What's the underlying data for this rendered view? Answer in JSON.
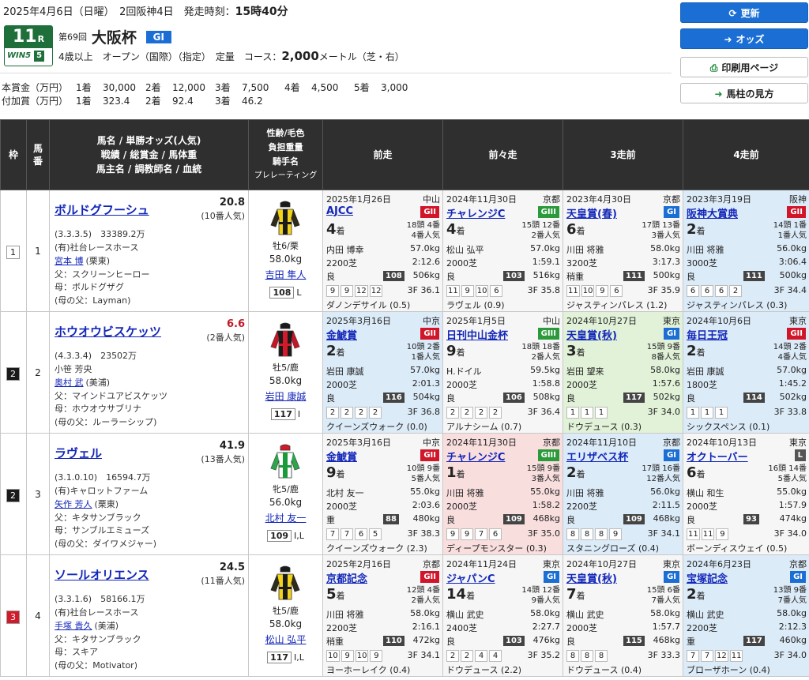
{
  "header": {
    "date_text": "2025年4月6日（日曜）　2回阪神4日　発走時刻：",
    "post_time": "15時40分",
    "race_number": "11",
    "race_number_suffix": "R",
    "win5_label": "WIN5",
    "win5_number": "5",
    "kai": "第69回",
    "race_name": "大阪杯",
    "grade": "GI",
    "conditions": "4歳以上　オープン（国際）（指定）　定量　コース：",
    "distance": "2,000",
    "course_detail": "メートル（芝・右）",
    "prize_label": "本賞金（万円）",
    "prize": [
      "1着",
      "30,000",
      "2着",
      "12,000",
      "3着",
      "7,500",
      "4着",
      "4,500",
      "5着",
      "3,000"
    ],
    "bonus_label": "付加賞（万円）",
    "bonus": [
      "1着",
      "323.4",
      "2着",
      "92.4",
      "3着",
      "46.2"
    ]
  },
  "buttons": {
    "refresh": "更新",
    "odds": "オッズ",
    "print": "印刷用ページ",
    "guide": "馬柱の見方"
  },
  "table_headers": {
    "waku": "枠",
    "umaban": "馬番",
    "horse_line1": "馬名 / 単勝オッズ(人気)",
    "horse_line2": "戦績 / 総賞金 / 馬体重",
    "horse_line3": "馬主名 / 調教師名 / 血統",
    "jockey_line1": "性齢/毛色",
    "jockey_line2": "負担重量",
    "jockey_line3": "騎手名",
    "jockey_line4": "プレレーティング",
    "past1": "前走",
    "past2": "前々走",
    "past3": "3走前",
    "past4": "4走前"
  },
  "horses": [
    {
      "waku": "1",
      "umaban": "1",
      "name": "ボルドグフーシュ",
      "odds": "20.8",
      "ninki": "(10番人気)",
      "record": "(3.3.3.5)　33389.2万",
      "owner": "(有)社台レースホース",
      "trainer": "宮本 博",
      "trainer_loc": "(栗東)",
      "sire": "父：スクリーンヒーロー",
      "dam": "母：ボルドグザグ",
      "damsire": "(母の父：Layman)",
      "sex": "牡6/栗",
      "weight": "58.0kg",
      "jockey": "吉田 隼人",
      "rating": "108",
      "rating_mark": "L",
      "silk": {
        "body": "#f2d21a",
        "stripe": "#1a1a1a",
        "sleeve": "#1a1a1a",
        "cap": "#1a1a1a"
      },
      "past": [
        {
          "date": "2025年1月26日",
          "venue": "中山",
          "race": "AJCC",
          "grade": "GII",
          "gclass": "gii",
          "rank": "4",
          "field": "18頭 4番",
          "pop": "4番人気",
          "jockey": "内田 博幸",
          "jw": "57.0kg",
          "course": "2200芝",
          "time": "2:12.6",
          "track": "良",
          "idx": "108",
          "bw": "506kg",
          "pos": [
            "9",
            "9",
            "12",
            "12"
          ],
          "f3": "3F 36.1",
          "winner": "ダノンデサイル (0.5)",
          "bg": "c0"
        },
        {
          "date": "2024年11月30日",
          "venue": "京都",
          "race": "チャレンジC",
          "grade": "GIII",
          "gclass": "giii",
          "rank": "4",
          "field": "15頭 12番",
          "pop": "2番人気",
          "jockey": "松山 弘平",
          "jw": "57.0kg",
          "course": "2000芝",
          "time": "1:59.1",
          "track": "良",
          "idx": "103",
          "bw": "516kg",
          "pos": [
            "11",
            "9",
            "10",
            "6"
          ],
          "f3": "3F 35.8",
          "winner": "ラヴェル (0.9)",
          "bg": "c0"
        },
        {
          "date": "2023年4月30日",
          "venue": "京都",
          "race": "天皇賞(春)",
          "grade": "GI",
          "gclass": "gi",
          "rank": "6",
          "field": "17頭 13番",
          "pop": "3番人気",
          "jockey": "川田 将雅",
          "jw": "58.0kg",
          "course": "3200芝",
          "time": "3:17.3",
          "track": "稍重",
          "idx": "111",
          "bw": "500kg",
          "pos": [
            "11",
            "10",
            "9",
            "6"
          ],
          "f3": "3F 35.9",
          "winner": "ジャスティンパレス (1.2)",
          "bg": "c0"
        },
        {
          "date": "2023年3月19日",
          "venue": "阪神",
          "race": "阪神大賞典",
          "grade": "GII",
          "gclass": "gii",
          "rank": "2",
          "field": "14頭 1番",
          "pop": "1番人気",
          "jockey": "川田 将雅",
          "jw": "56.0kg",
          "course": "3000芝",
          "time": "3:06.4",
          "track": "良",
          "idx": "111",
          "bw": "500kg",
          "pos": [
            "6",
            "6",
            "6",
            "2"
          ],
          "f3": "3F 34.4",
          "winner": "ジャスティンパレス (0.3)",
          "bg": "c1"
        }
      ]
    },
    {
      "waku": "2",
      "umaban": "2",
      "name": "ホウオウビスケッツ",
      "odds": "6.6",
      "ninki": "(2番人気)",
      "record": "(4.3.3.4)　23502万",
      "owner": "小笹 芳央",
      "trainer": "奥村 武",
      "trainer_loc": "(美浦)",
      "sire": "父：マインドユアビスケッツ",
      "dam": "母：ホウオウサブリナ",
      "damsire": "(母の父：ルーラーシップ)",
      "sex": "牡5/鹿",
      "weight": "58.0kg",
      "jockey": "岩田 康誠",
      "rating": "117",
      "rating_mark": "I",
      "silk": {
        "body": "#1a1a1a",
        "stripe": "#d21a2a",
        "sleeve": "#d21a2a",
        "cap": "#1a1a1a"
      },
      "past": [
        {
          "date": "2025年3月16日",
          "venue": "中京",
          "race": "金鯱賞",
          "grade": "GII",
          "gclass": "gii",
          "rank": "2",
          "field": "10頭 2番",
          "pop": "1番人気",
          "jockey": "岩田 康誠",
          "jw": "57.0kg",
          "course": "2000芝",
          "time": "2:01.3",
          "track": "良",
          "idx": "116",
          "bw": "504kg",
          "pos": [
            "2",
            "2",
            "2",
            "2"
          ],
          "f3": "3F 36.8",
          "winner": "クイーンズウォーク (0.0)",
          "bg": "c1"
        },
        {
          "date": "2025年1月5日",
          "venue": "中山",
          "race": "日刊中山金杯",
          "grade": "GIII",
          "gclass": "giii",
          "rank": "9",
          "field": "18頭 18番",
          "pop": "2番人気",
          "jockey": "H.ドイル",
          "jw": "59.5kg",
          "course": "2000芝",
          "time": "1:58.8",
          "track": "良",
          "idx": "106",
          "bw": "508kg",
          "pos": [
            "2",
            "2",
            "2",
            "2"
          ],
          "f3": "3F 36.4",
          "winner": "アルナシーム (0.7)",
          "bg": "c0"
        },
        {
          "date": "2024年10月27日",
          "venue": "東京",
          "race": "天皇賞(秋)",
          "grade": "GI",
          "gclass": "gi",
          "rank": "3",
          "field": "15頭 9番",
          "pop": "8番人気",
          "jockey": "岩田 望来",
          "jw": "58.0kg",
          "course": "2000芝",
          "time": "1:57.6",
          "track": "良",
          "idx": "117",
          "bw": "502kg",
          "pos": [
            "1",
            "1",
            "1"
          ],
          "f3": "3F 34.0",
          "winner": "ドウデュース (0.3)",
          "bg": "c2"
        },
        {
          "date": "2024年10月6日",
          "venue": "東京",
          "race": "毎日王冠",
          "grade": "GII",
          "gclass": "gii",
          "rank": "2",
          "field": "14頭 2番",
          "pop": "4番人気",
          "jockey": "岩田 康誠",
          "jw": "57.0kg",
          "course": "1800芝",
          "time": "1:45.2",
          "track": "良",
          "idx": "114",
          "bw": "502kg",
          "pos": [
            "1",
            "1",
            "1"
          ],
          "f3": "3F 33.8",
          "winner": "シックスペンス (0.1)",
          "bg": "c1"
        }
      ]
    },
    {
      "waku": "2",
      "umaban": "3",
      "name": "ラヴェル",
      "odds": "41.9",
      "ninki": "(13番人気)",
      "record": "(3.1.0.10)　16594.7万",
      "owner": "(有)キャロットファーム",
      "trainer": "矢作 芳人",
      "trainer_loc": "(栗東)",
      "sire": "父：キタサンブラック",
      "dam": "母：サンブルエミューズ",
      "damsire": "(母の父：ダイワメジャー)",
      "sex": "牝5/鹿",
      "weight": "56.0kg",
      "jockey": "北村 友一",
      "rating": "109",
      "rating_mark": "I,L",
      "silk": {
        "body": "#ffffff",
        "stripe": "#1a9a3a",
        "sleeve": "#1a9a3a",
        "cap": "#d21a2a"
      },
      "past": [
        {
          "date": "2025年3月16日",
          "venue": "中京",
          "race": "金鯱賞",
          "grade": "GII",
          "gclass": "gii",
          "rank": "9",
          "field": "10頭 9番",
          "pop": "5番人気",
          "jockey": "北村 友一",
          "jw": "55.0kg",
          "course": "2000芝",
          "time": "2:03.6",
          "track": "重",
          "idx": "88",
          "bw": "480kg",
          "pos": [
            "7",
            "7",
            "6",
            "5"
          ],
          "f3": "3F 38.3",
          "winner": "クイーンズウォーク (2.3)",
          "bg": "c0"
        },
        {
          "date": "2024年11月30日",
          "venue": "京都",
          "race": "チャレンジC",
          "grade": "GIII",
          "gclass": "giii",
          "rank": "1",
          "field": "15頭 9番",
          "pop": "3番人気",
          "jockey": "川田 将雅",
          "jw": "55.0kg",
          "course": "2000芝",
          "time": "1:58.2",
          "track": "良",
          "idx": "109",
          "bw": "468kg",
          "pos": [
            "9",
            "9",
            "7",
            "6"
          ],
          "f3": "3F 35.0",
          "winner": "ディープモンスター (0.3)",
          "bg": "c3"
        },
        {
          "date": "2024年11月10日",
          "venue": "京都",
          "race": "エリザベス杯",
          "grade": "GI",
          "gclass": "gi",
          "rank": "2",
          "field": "17頭 16番",
          "pop": "12番人気",
          "jockey": "川田 将雅",
          "jw": "56.0kg",
          "course": "2200芝",
          "time": "2:11.5",
          "track": "良",
          "idx": "109",
          "bw": "468kg",
          "pos": [
            "8",
            "8",
            "8",
            "9"
          ],
          "f3": "3F 34.1",
          "winner": "スタニングローズ (0.4)",
          "bg": "c1"
        },
        {
          "date": "2024年10月13日",
          "venue": "東京",
          "race": "オクトーバー",
          "grade": "L",
          "gclass": "l",
          "rank": "6",
          "field": "16頭 14番",
          "pop": "5番人気",
          "jockey": "横山 和生",
          "jw": "55.0kg",
          "course": "2000芝",
          "time": "1:57.9",
          "track": "良",
          "idx": "93",
          "bw": "474kg",
          "pos": [
            "11",
            "11",
            "9"
          ],
          "f3": "3F 34.0",
          "winner": "ボーンディスウェイ (0.5)",
          "bg": "c0"
        }
      ]
    },
    {
      "waku": "3",
      "umaban": "4",
      "name": "ソールオリエンス",
      "odds": "24.5",
      "ninki": "(11番人気)",
      "record": "(3.3.1.6)　58166.1万",
      "owner": "(有)社台レースホース",
      "trainer": "手塚 貴久",
      "trainer_loc": "(美浦)",
      "sire": "父：キタサンブラック",
      "dam": "母：スキア",
      "damsire": "(母の父：Motivator)",
      "sex": "牡5/鹿",
      "weight": "58.0kg",
      "jockey": "松山 弘平",
      "rating": "117",
      "rating_mark": "I,L",
      "silk": {
        "body": "#f2d21a",
        "stripe": "#1a1a1a",
        "sleeve": "#1a1a1a",
        "cap": "#1a1a1a"
      },
      "past": [
        {
          "date": "2025年2月16日",
          "venue": "京都",
          "race": "京都記念",
          "grade": "GII",
          "gclass": "gii",
          "rank": "5",
          "field": "12頭 4番",
          "pop": "2番人気",
          "jockey": "川田 将雅",
          "jw": "58.0kg",
          "course": "2200芝",
          "time": "2:16.1",
          "track": "稍重",
          "idx": "110",
          "bw": "472kg",
          "pos": [
            "10",
            "9",
            "10",
            "9"
          ],
          "f3": "3F 34.1",
          "winner": "ヨーホーレイク (0.4)",
          "bg": "c0"
        },
        {
          "date": "2024年11月24日",
          "venue": "東京",
          "race": "ジャパンC",
          "grade": "GI",
          "gclass": "gi",
          "rank": "14",
          "field": "14頭 12番",
          "pop": "9番人気",
          "jockey": "横山 武史",
          "jw": "58.0kg",
          "course": "2400芝",
          "time": "2:27.7",
          "track": "良",
          "idx": "103",
          "bw": "476kg",
          "pos": [
            "2",
            "2",
            "4",
            "4"
          ],
          "f3": "3F 35.2",
          "winner": "ドウデュース (2.2)",
          "bg": "c0"
        },
        {
          "date": "2024年10月27日",
          "venue": "東京",
          "race": "天皇賞(秋)",
          "grade": "GI",
          "gclass": "gi",
          "rank": "7",
          "field": "15頭 6番",
          "pop": "7番人気",
          "jockey": "横山 武史",
          "jw": "58.0kg",
          "course": "2000芝",
          "time": "1:57.7",
          "track": "良",
          "idx": "115",
          "bw": "468kg",
          "pos": [
            "8",
            "8",
            "8"
          ],
          "f3": "3F 33.3",
          "winner": "ドウデュース (0.4)",
          "bg": "c0"
        },
        {
          "date": "2024年6月23日",
          "venue": "京都",
          "race": "宝塚記念",
          "grade": "GI",
          "gclass": "gi",
          "rank": "2",
          "field": "13頭 9番",
          "pop": "7番人気",
          "jockey": "横山 武史",
          "jw": "58.0kg",
          "course": "2200芝",
          "time": "2:12.3",
          "track": "重",
          "idx": "117",
          "bw": "460kg",
          "pos": [
            "7",
            "7",
            "12",
            "11"
          ],
          "f3": "3F 34.0",
          "winner": "ブローザホーン (0.4)",
          "bg": "c1"
        }
      ]
    }
  ]
}
